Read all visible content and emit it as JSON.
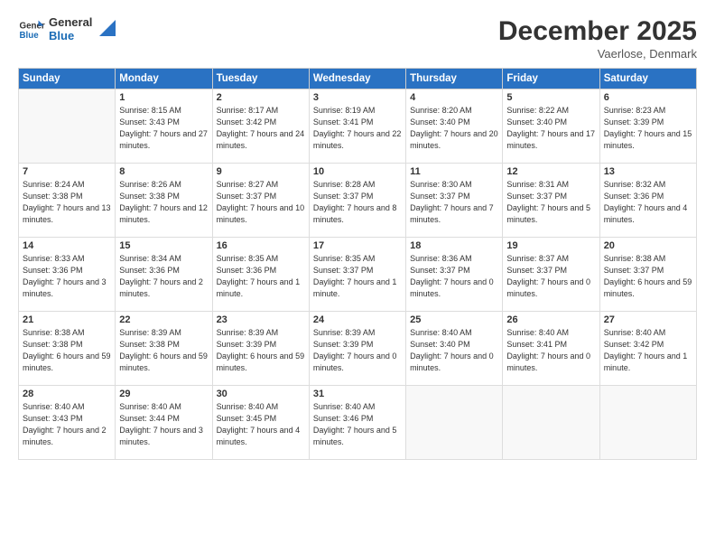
{
  "header": {
    "logo_general": "General",
    "logo_blue": "Blue",
    "month_title": "December 2025",
    "location": "Vaerlose, Denmark"
  },
  "days_of_week": [
    "Sunday",
    "Monday",
    "Tuesday",
    "Wednesday",
    "Thursday",
    "Friday",
    "Saturday"
  ],
  "weeks": [
    [
      {
        "day": "",
        "info": ""
      },
      {
        "day": "1",
        "info": "Sunrise: 8:15 AM\nSunset: 3:43 PM\nDaylight: 7 hours\nand 27 minutes."
      },
      {
        "day": "2",
        "info": "Sunrise: 8:17 AM\nSunset: 3:42 PM\nDaylight: 7 hours\nand 24 minutes."
      },
      {
        "day": "3",
        "info": "Sunrise: 8:19 AM\nSunset: 3:41 PM\nDaylight: 7 hours\nand 22 minutes."
      },
      {
        "day": "4",
        "info": "Sunrise: 8:20 AM\nSunset: 3:40 PM\nDaylight: 7 hours\nand 20 minutes."
      },
      {
        "day": "5",
        "info": "Sunrise: 8:22 AM\nSunset: 3:40 PM\nDaylight: 7 hours\nand 17 minutes."
      },
      {
        "day": "6",
        "info": "Sunrise: 8:23 AM\nSunset: 3:39 PM\nDaylight: 7 hours\nand 15 minutes."
      }
    ],
    [
      {
        "day": "7",
        "info": "Sunrise: 8:24 AM\nSunset: 3:38 PM\nDaylight: 7 hours\nand 13 minutes."
      },
      {
        "day": "8",
        "info": "Sunrise: 8:26 AM\nSunset: 3:38 PM\nDaylight: 7 hours\nand 12 minutes."
      },
      {
        "day": "9",
        "info": "Sunrise: 8:27 AM\nSunset: 3:37 PM\nDaylight: 7 hours\nand 10 minutes."
      },
      {
        "day": "10",
        "info": "Sunrise: 8:28 AM\nSunset: 3:37 PM\nDaylight: 7 hours\nand 8 minutes."
      },
      {
        "day": "11",
        "info": "Sunrise: 8:30 AM\nSunset: 3:37 PM\nDaylight: 7 hours\nand 7 minutes."
      },
      {
        "day": "12",
        "info": "Sunrise: 8:31 AM\nSunset: 3:37 PM\nDaylight: 7 hours\nand 5 minutes."
      },
      {
        "day": "13",
        "info": "Sunrise: 8:32 AM\nSunset: 3:36 PM\nDaylight: 7 hours\nand 4 minutes."
      }
    ],
    [
      {
        "day": "14",
        "info": "Sunrise: 8:33 AM\nSunset: 3:36 PM\nDaylight: 7 hours\nand 3 minutes."
      },
      {
        "day": "15",
        "info": "Sunrise: 8:34 AM\nSunset: 3:36 PM\nDaylight: 7 hours\nand 2 minutes."
      },
      {
        "day": "16",
        "info": "Sunrise: 8:35 AM\nSunset: 3:36 PM\nDaylight: 7 hours\nand 1 minute."
      },
      {
        "day": "17",
        "info": "Sunrise: 8:35 AM\nSunset: 3:37 PM\nDaylight: 7 hours\nand 1 minute."
      },
      {
        "day": "18",
        "info": "Sunrise: 8:36 AM\nSunset: 3:37 PM\nDaylight: 7 hours\nand 0 minutes."
      },
      {
        "day": "19",
        "info": "Sunrise: 8:37 AM\nSunset: 3:37 PM\nDaylight: 7 hours\nand 0 minutes."
      },
      {
        "day": "20",
        "info": "Sunrise: 8:38 AM\nSunset: 3:37 PM\nDaylight: 6 hours\nand 59 minutes."
      }
    ],
    [
      {
        "day": "21",
        "info": "Sunrise: 8:38 AM\nSunset: 3:38 PM\nDaylight: 6 hours\nand 59 minutes."
      },
      {
        "day": "22",
        "info": "Sunrise: 8:39 AM\nSunset: 3:38 PM\nDaylight: 6 hours\nand 59 minutes."
      },
      {
        "day": "23",
        "info": "Sunrise: 8:39 AM\nSunset: 3:39 PM\nDaylight: 6 hours\nand 59 minutes."
      },
      {
        "day": "24",
        "info": "Sunrise: 8:39 AM\nSunset: 3:39 PM\nDaylight: 7 hours\nand 0 minutes."
      },
      {
        "day": "25",
        "info": "Sunrise: 8:40 AM\nSunset: 3:40 PM\nDaylight: 7 hours\nand 0 minutes."
      },
      {
        "day": "26",
        "info": "Sunrise: 8:40 AM\nSunset: 3:41 PM\nDaylight: 7 hours\nand 0 minutes."
      },
      {
        "day": "27",
        "info": "Sunrise: 8:40 AM\nSunset: 3:42 PM\nDaylight: 7 hours\nand 1 minute."
      }
    ],
    [
      {
        "day": "28",
        "info": "Sunrise: 8:40 AM\nSunset: 3:43 PM\nDaylight: 7 hours\nand 2 minutes."
      },
      {
        "day": "29",
        "info": "Sunrise: 8:40 AM\nSunset: 3:44 PM\nDaylight: 7 hours\nand 3 minutes."
      },
      {
        "day": "30",
        "info": "Sunrise: 8:40 AM\nSunset: 3:45 PM\nDaylight: 7 hours\nand 4 minutes."
      },
      {
        "day": "31",
        "info": "Sunrise: 8:40 AM\nSunset: 3:46 PM\nDaylight: 7 hours\nand 5 minutes."
      },
      {
        "day": "",
        "info": ""
      },
      {
        "day": "",
        "info": ""
      },
      {
        "day": "",
        "info": ""
      }
    ]
  ]
}
